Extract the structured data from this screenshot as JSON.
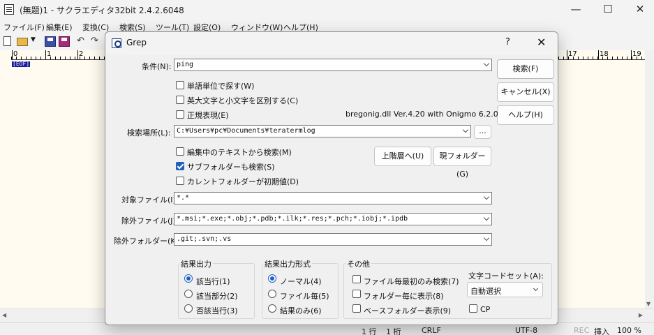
{
  "app": {
    "title": "(無題)1 - サクラエディタ32bit 2.4.2.6048",
    "minimize_icon": "—",
    "maximize_icon": "☐",
    "close_icon": "✕"
  },
  "menu": [
    "ファイル(F)",
    "編集(E)",
    "変換(C)",
    "検索(S)",
    "ツール(T)",
    "設定(O)",
    "ウィンドウ(W)",
    "ヘルプ(H)"
  ],
  "ruler": {
    "labels": [
      "0",
      "1",
      "2",
      "17",
      "18",
      "19"
    ]
  },
  "editor": {
    "eof_marker": "[EOF]"
  },
  "statusbar": {
    "line": "1 行",
    "col": "1 桁",
    "eol": "CRLF",
    "encoding": "UTF-8",
    "rec": "REC",
    "insert": "挿入",
    "zoom": "100 %"
  },
  "dialog": {
    "title": "Grep",
    "help_label": "?",
    "close_label": "✕",
    "condition_label": "条件(N):",
    "condition_value": "ping",
    "word_search": "単語単位で探す(W)",
    "case_sensitive": "英大文字と小文字を区別する(C)",
    "regex": "正規表現(E)",
    "regex_lib": "bregonig.dll Ver.4.20 with Onigmo 6.2.0",
    "location_label": "検索場所(L):",
    "location_value": "C:¥Users¥pc¥Documents¥teratermlog",
    "browse_label": "...",
    "from_editing": "編集中のテキストから検索(M)",
    "subfolders": "サブフォルダーも検索(S)",
    "current_folder_default": "カレントフォルダーが初期値(D)",
    "parent_button": "上階層へ(U)",
    "current_folder_button": "現フォルダー(G)",
    "target_files_label": "対象ファイル(I):",
    "target_files_value": "*.*",
    "exclude_files_label": "除外ファイル(J):",
    "exclude_files_value": "*.msi;*.exe;*.obj;*.pdb;*.ilk;*.res;*.pch;*.iobj;*.ipdb",
    "exclude_folders_label": "除外フォルダー(K):",
    "exclude_folders_value": ".git;.svn;.vs",
    "search_button": "検索(F)",
    "cancel_button": "キャンセル(X)",
    "help_button": "ヘルプ(H)",
    "result_output": {
      "title": "結果出力",
      "options": [
        "該当行(1)",
        "該当部分(2)",
        "否該当行(3)"
      ]
    },
    "result_format": {
      "title": "結果出力形式",
      "options": [
        "ノーマル(4)",
        "ファイル毎(5)",
        "結果のみ(6)"
      ]
    },
    "other": {
      "title": "その他",
      "options": [
        "ファイル毎最初のみ検索(7)",
        "フォルダー毎に表示(8)",
        "ベースフォルダー表示(9)"
      ]
    },
    "charset_label": "文字コードセット(A):",
    "charset_value": "自動選択",
    "cp_label": "CP"
  }
}
